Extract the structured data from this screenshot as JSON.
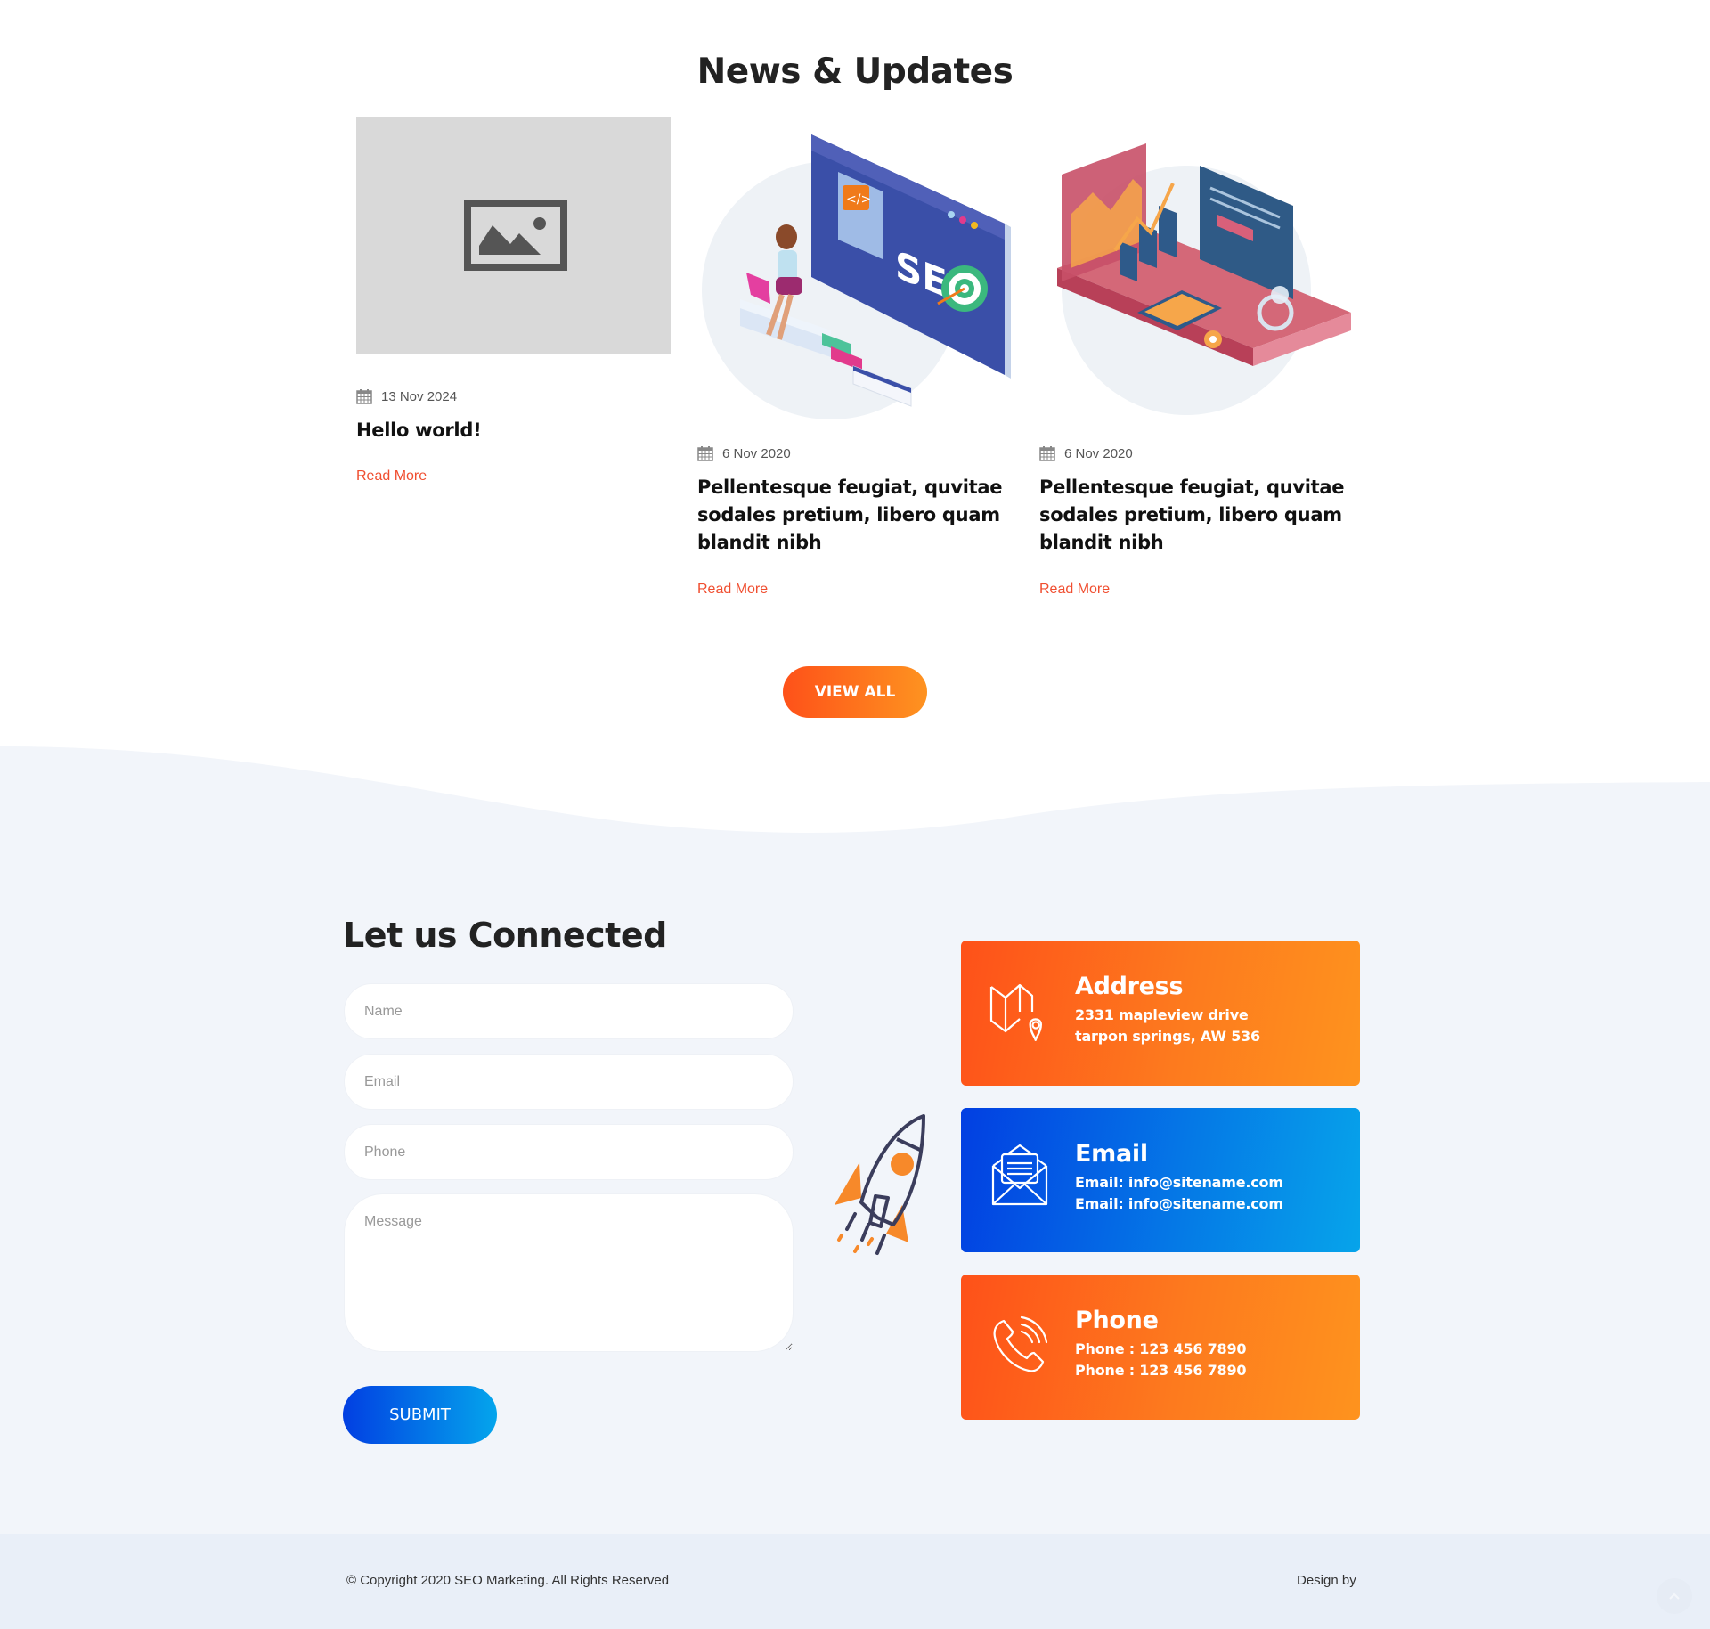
{
  "news": {
    "title": "News & Updates",
    "posts": [
      {
        "image": "placeholder-image",
        "date": "13 Nov 2024",
        "title": "Hello world!",
        "read_more": "Read More"
      },
      {
        "image": "seo-illustration",
        "date": "6 Nov 2020",
        "title": "Pellentesque feugiat, quvitae sodales pretium, libero quam blandit nibh",
        "read_more": "Read More"
      },
      {
        "image": "marketing-illustration",
        "date": "6 Nov 2020",
        "title": "Pellentesque feugiat, quvitae sodales pretium, libero quam blandit nibh",
        "read_more": "Read More"
      }
    ],
    "view_all_label": "VIEW ALL"
  },
  "contact": {
    "title": "Let us Connected",
    "form": {
      "name_placeholder": "Name",
      "email_placeholder": "Email",
      "phone_placeholder": "Phone",
      "message_placeholder": "Message",
      "name_value": "",
      "email_value": "",
      "phone_value": "",
      "message_value": "",
      "submit_label": "SUBMIT"
    },
    "cards": [
      {
        "icon": "map-pin-icon",
        "title": "Address",
        "lines": [
          "2331 mapleview drive",
          "tarpon springs, AW 536"
        ]
      },
      {
        "icon": "envelope-icon",
        "title": "Email",
        "lines": [
          "Email: info@sitename.com",
          "Email: info@sitename.com"
        ]
      },
      {
        "icon": "phone-icon",
        "title": "Phone",
        "lines": [
          "Phone : 123 456 7890",
          "Phone : 123 456 7890"
        ]
      }
    ]
  },
  "footer": {
    "copyright": "© Copyright 2020 SEO Marketing. All Rights Reserved",
    "design_by": "Design by"
  },
  "colors": {
    "accent_orange_start": "#fe5119",
    "accent_orange_end": "#fe931e",
    "accent_blue_start": "#023fe2",
    "accent_blue_end": "#06a4ea",
    "read_more": "#f04e30",
    "section_bg": "#f2f5fa",
    "footer_bg": "#e9eff8"
  }
}
